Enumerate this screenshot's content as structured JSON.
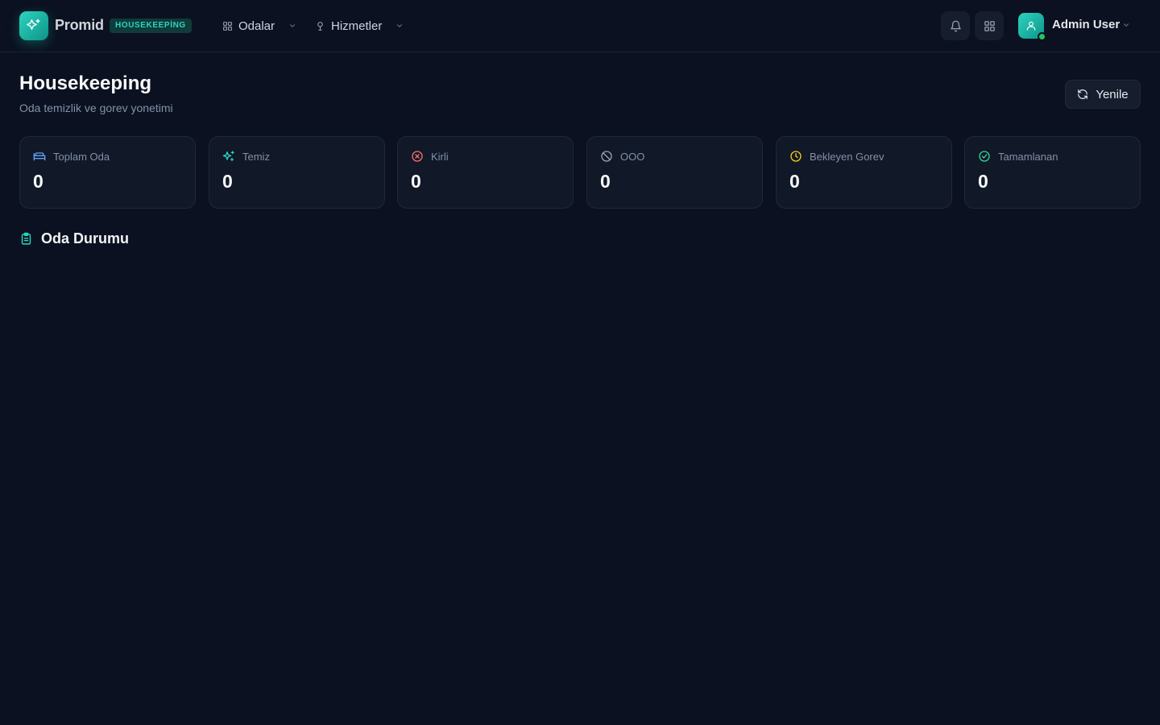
{
  "header": {
    "brand": "Promid",
    "module_badge": "HOUSEKEEPİNG",
    "nav": [
      {
        "label": "Odalar",
        "icon": "grid-icon"
      },
      {
        "label": "Hizmetler",
        "icon": "service-icon"
      }
    ],
    "user_name": "Admin User"
  },
  "page": {
    "title": "Housekeeping",
    "subtitle": "Oda temizlik ve gorev yonetimi",
    "refresh_label": "Yenile"
  },
  "stats": [
    {
      "label": "Toplam Oda",
      "value": "0",
      "icon": "bed-icon",
      "color": "#60a5fa"
    },
    {
      "label": "Temiz",
      "value": "0",
      "icon": "sparkles-icon",
      "color": "#2dd4bf"
    },
    {
      "label": "Kirli",
      "value": "0",
      "icon": "x-circle-icon",
      "color": "#f87171"
    },
    {
      "label": "OOO",
      "value": "0",
      "icon": "ban-icon",
      "color": "#9ca3af"
    },
    {
      "label": "Bekleyen Gorev",
      "value": "0",
      "icon": "clock-icon",
      "color": "#facc15"
    },
    {
      "label": "Tamamlanan",
      "value": "0",
      "icon": "check-circle-icon",
      "color": "#34d399"
    }
  ],
  "section": {
    "title": "Oda Durumu",
    "icon": "clipboard-icon"
  },
  "colors": {
    "background": "#0b1120",
    "card": "#111827",
    "accent": "#14b8a6"
  }
}
